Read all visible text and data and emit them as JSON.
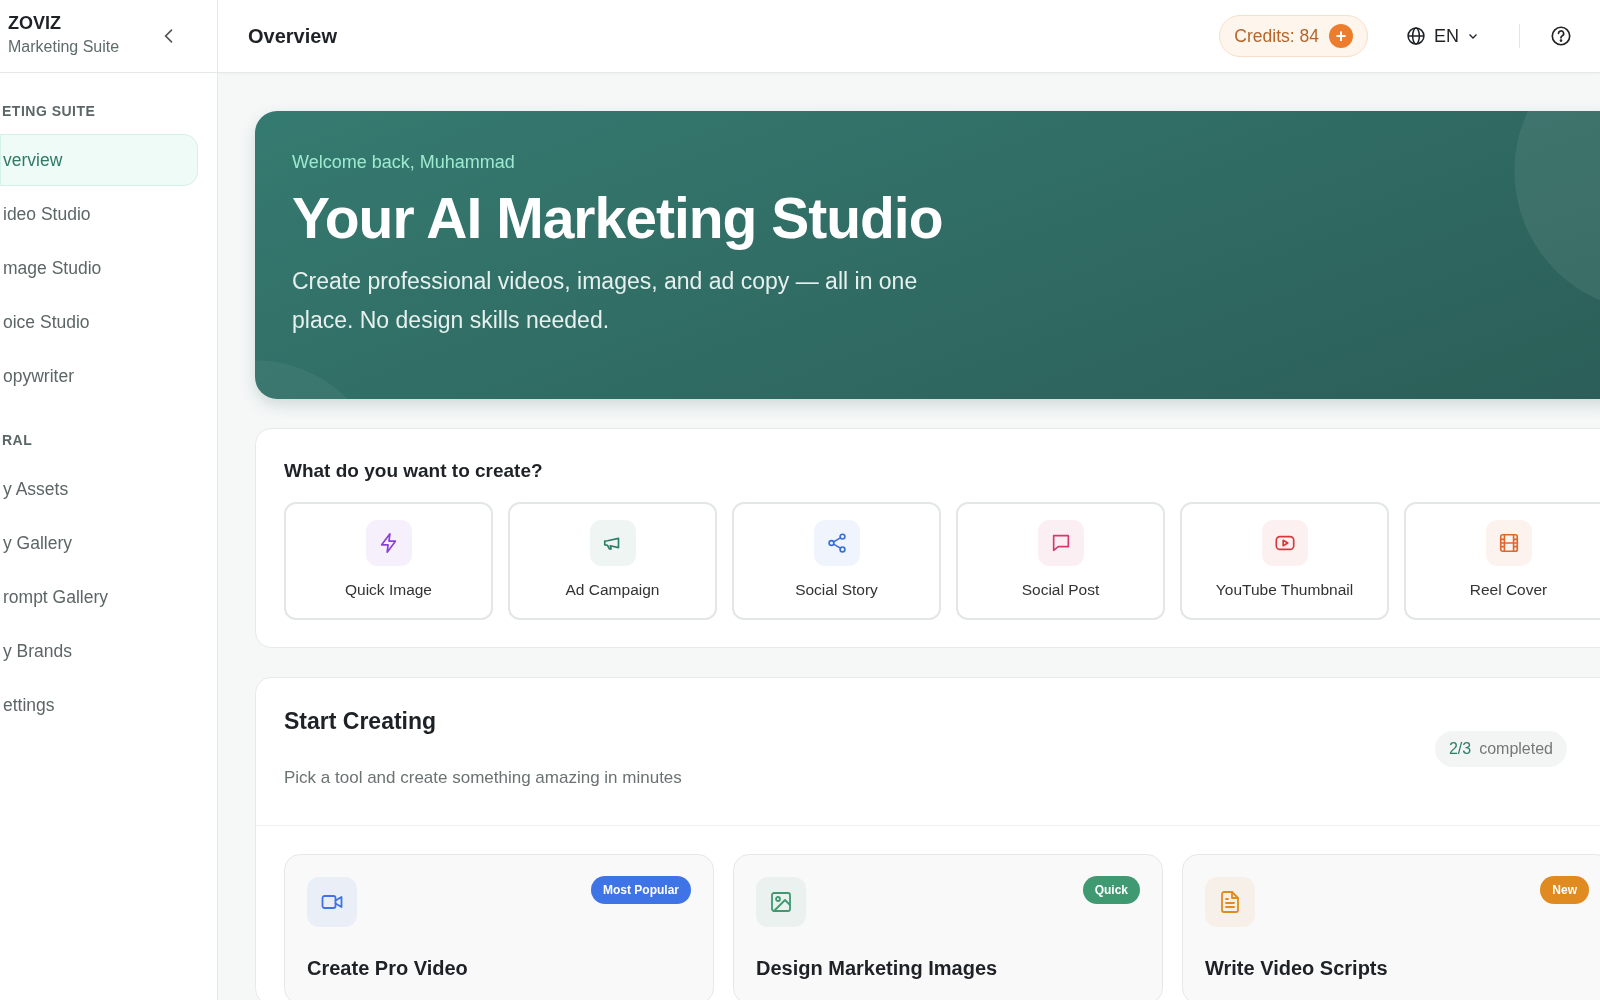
{
  "sidebar": {
    "brand": "ZOVIZ",
    "subtitle": "Marketing Suite",
    "sections": [
      {
        "heading": "ETING SUITE",
        "items": [
          {
            "label": "verview",
            "selected": true
          },
          {
            "label": "ideo Studio",
            "selected": false
          },
          {
            "label": "mage Studio",
            "selected": false
          },
          {
            "label": "oice Studio",
            "selected": false
          },
          {
            "label": "opywriter",
            "selected": false
          }
        ]
      },
      {
        "heading": "RAL",
        "items": [
          {
            "label": "y Assets",
            "selected": false
          },
          {
            "label": "y Gallery",
            "selected": false
          },
          {
            "label": "rompt Gallery",
            "selected": false
          },
          {
            "label": "y Brands",
            "selected": false
          },
          {
            "label": "ettings",
            "selected": false
          }
        ]
      }
    ]
  },
  "header": {
    "title": "Overview",
    "credits": "Credits: 84",
    "credits_add": "+",
    "language": "EN"
  },
  "hero": {
    "greeting": "Welcome back, Muhammad",
    "title": "Your AI Marketing Studio",
    "description": "Create professional videos, images, and ad copy — all in one place. No design skills needed."
  },
  "quick_create": {
    "title": "What do you want to create?",
    "items": [
      {
        "label": "Quick Image",
        "kind": "bolt",
        "color": "#8b3fd9"
      },
      {
        "label": "Ad Campaign",
        "kind": "megaphone",
        "color": "#2f7d68"
      },
      {
        "label": "Social Story",
        "kind": "share",
        "color": "#3b6fd8"
      },
      {
        "label": "Social Post",
        "kind": "message",
        "color": "#d4386e"
      },
      {
        "label": "YouTube Thumbnail",
        "kind": "play",
        "color": "#d43a3a"
      },
      {
        "label": "Reel Cover",
        "kind": "film",
        "color": "#e0672a"
      }
    ]
  },
  "start_creating": {
    "title": "Start Creating",
    "subtitle": "Pick a tool and create something amazing in minutes",
    "progress_done": "2/3",
    "progress_label": "completed",
    "tools": [
      {
        "title": "Create Pro Video",
        "kind": "video",
        "badge": "Most Popular",
        "color": "#3f74e6"
      },
      {
        "title": "Design Marketing Images",
        "kind": "image",
        "badge": "Quick",
        "color": "#3f9a72"
      },
      {
        "title": "Write Video Scripts",
        "kind": "document",
        "badge": "New",
        "color": "#e08a22"
      }
    ]
  }
}
